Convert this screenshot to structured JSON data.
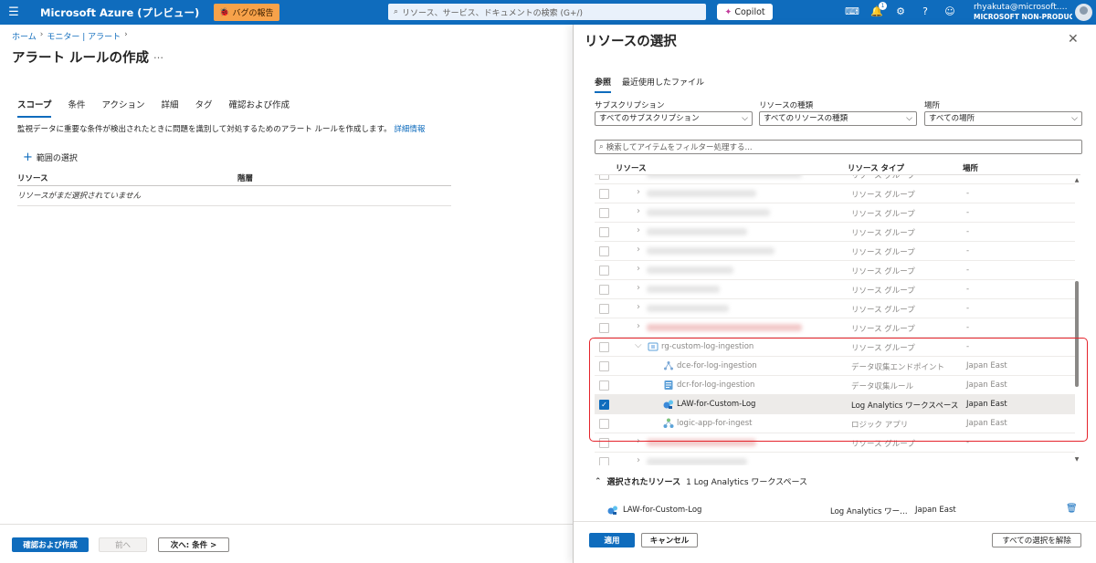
{
  "topbar": {
    "brand": "Microsoft Azure (プレビュー)",
    "bug_report": "バグの報告",
    "search_placeholder": "リソース、サービス、ドキュメントの検索 (G+/)",
    "copilot": "Copilot",
    "notification_count": "1",
    "account_email": "rhyakuta@microsoft.…",
    "account_tenant": "MICROSOFT NON-PRODUC…"
  },
  "left": {
    "breadcrumb": [
      "ホーム",
      "モニター | アラート"
    ],
    "title": "アラート ルールの作成",
    "more": "…",
    "tabs": [
      "スコープ",
      "条件",
      "アクション",
      "詳細",
      "タグ",
      "確認および作成"
    ],
    "description": "監視データに重要な条件が検出されたときに問題を識別して対処するためのアラート ルールを作成します。",
    "learn_more": "詳細情報",
    "add_scope": "範囲の選択",
    "table_headers": [
      "リソース",
      "階層"
    ],
    "empty_text": "リソースがまだ選択されていません",
    "footer": {
      "review": "確認および作成",
      "previous": "前へ",
      "next": "次へ: 条件 >"
    }
  },
  "panel": {
    "title": "リソースの選択",
    "tabs": [
      "参照",
      "最近使用したファイル"
    ],
    "filters": [
      {
        "label": "サブスクリプション",
        "value": "すべてのサブスクリプション"
      },
      {
        "label": "リソースの種類",
        "value": "すべてのリソースの種類"
      },
      {
        "label": "場所",
        "value": "すべての場所"
      }
    ],
    "filter_placeholder": "検索してアイテムをフィルター処理する...",
    "columns": [
      "リソース",
      "リソース タイプ",
      "場所"
    ],
    "blurred_type": "リソース グループ",
    "blurred_loc": "-",
    "group": {
      "name": "rg-custom-log-ingestion",
      "type": "リソース グループ",
      "loc": "-"
    },
    "children": [
      {
        "name": "dce-for-log-ingestion",
        "type": "データ収集エンドポイント",
        "loc": "Japan East",
        "icon": "cloud-endpoint-icon",
        "checked": false
      },
      {
        "name": "dcr-for-log-ingestion",
        "type": "データ収集ルール",
        "loc": "Japan East",
        "icon": "data-rule-icon",
        "checked": false
      },
      {
        "name": "LAW-for-Custom-Log",
        "type": "Log Analytics ワークスペース",
        "loc": "Japan East",
        "icon": "log-analytics-icon",
        "checked": true
      },
      {
        "name": "logic-app-for-ingest",
        "type": "ロジック アプリ",
        "loc": "Japan East",
        "icon": "logic-app-icon",
        "checked": false
      }
    ],
    "selected_header": "選択されたリソース",
    "selected_count": "1 Log Analytics ワークスペース",
    "selected_item": {
      "name": "LAW-for-Custom-Log",
      "type": "Log Analytics ワー…",
      "loc": "Japan East"
    },
    "footer": {
      "apply": "適用",
      "cancel": "キャンセル",
      "clear_all": "すべての選択を解除"
    }
  },
  "colors": {
    "accent": "#0f6cbd",
    "highlight": "#e5232b"
  }
}
